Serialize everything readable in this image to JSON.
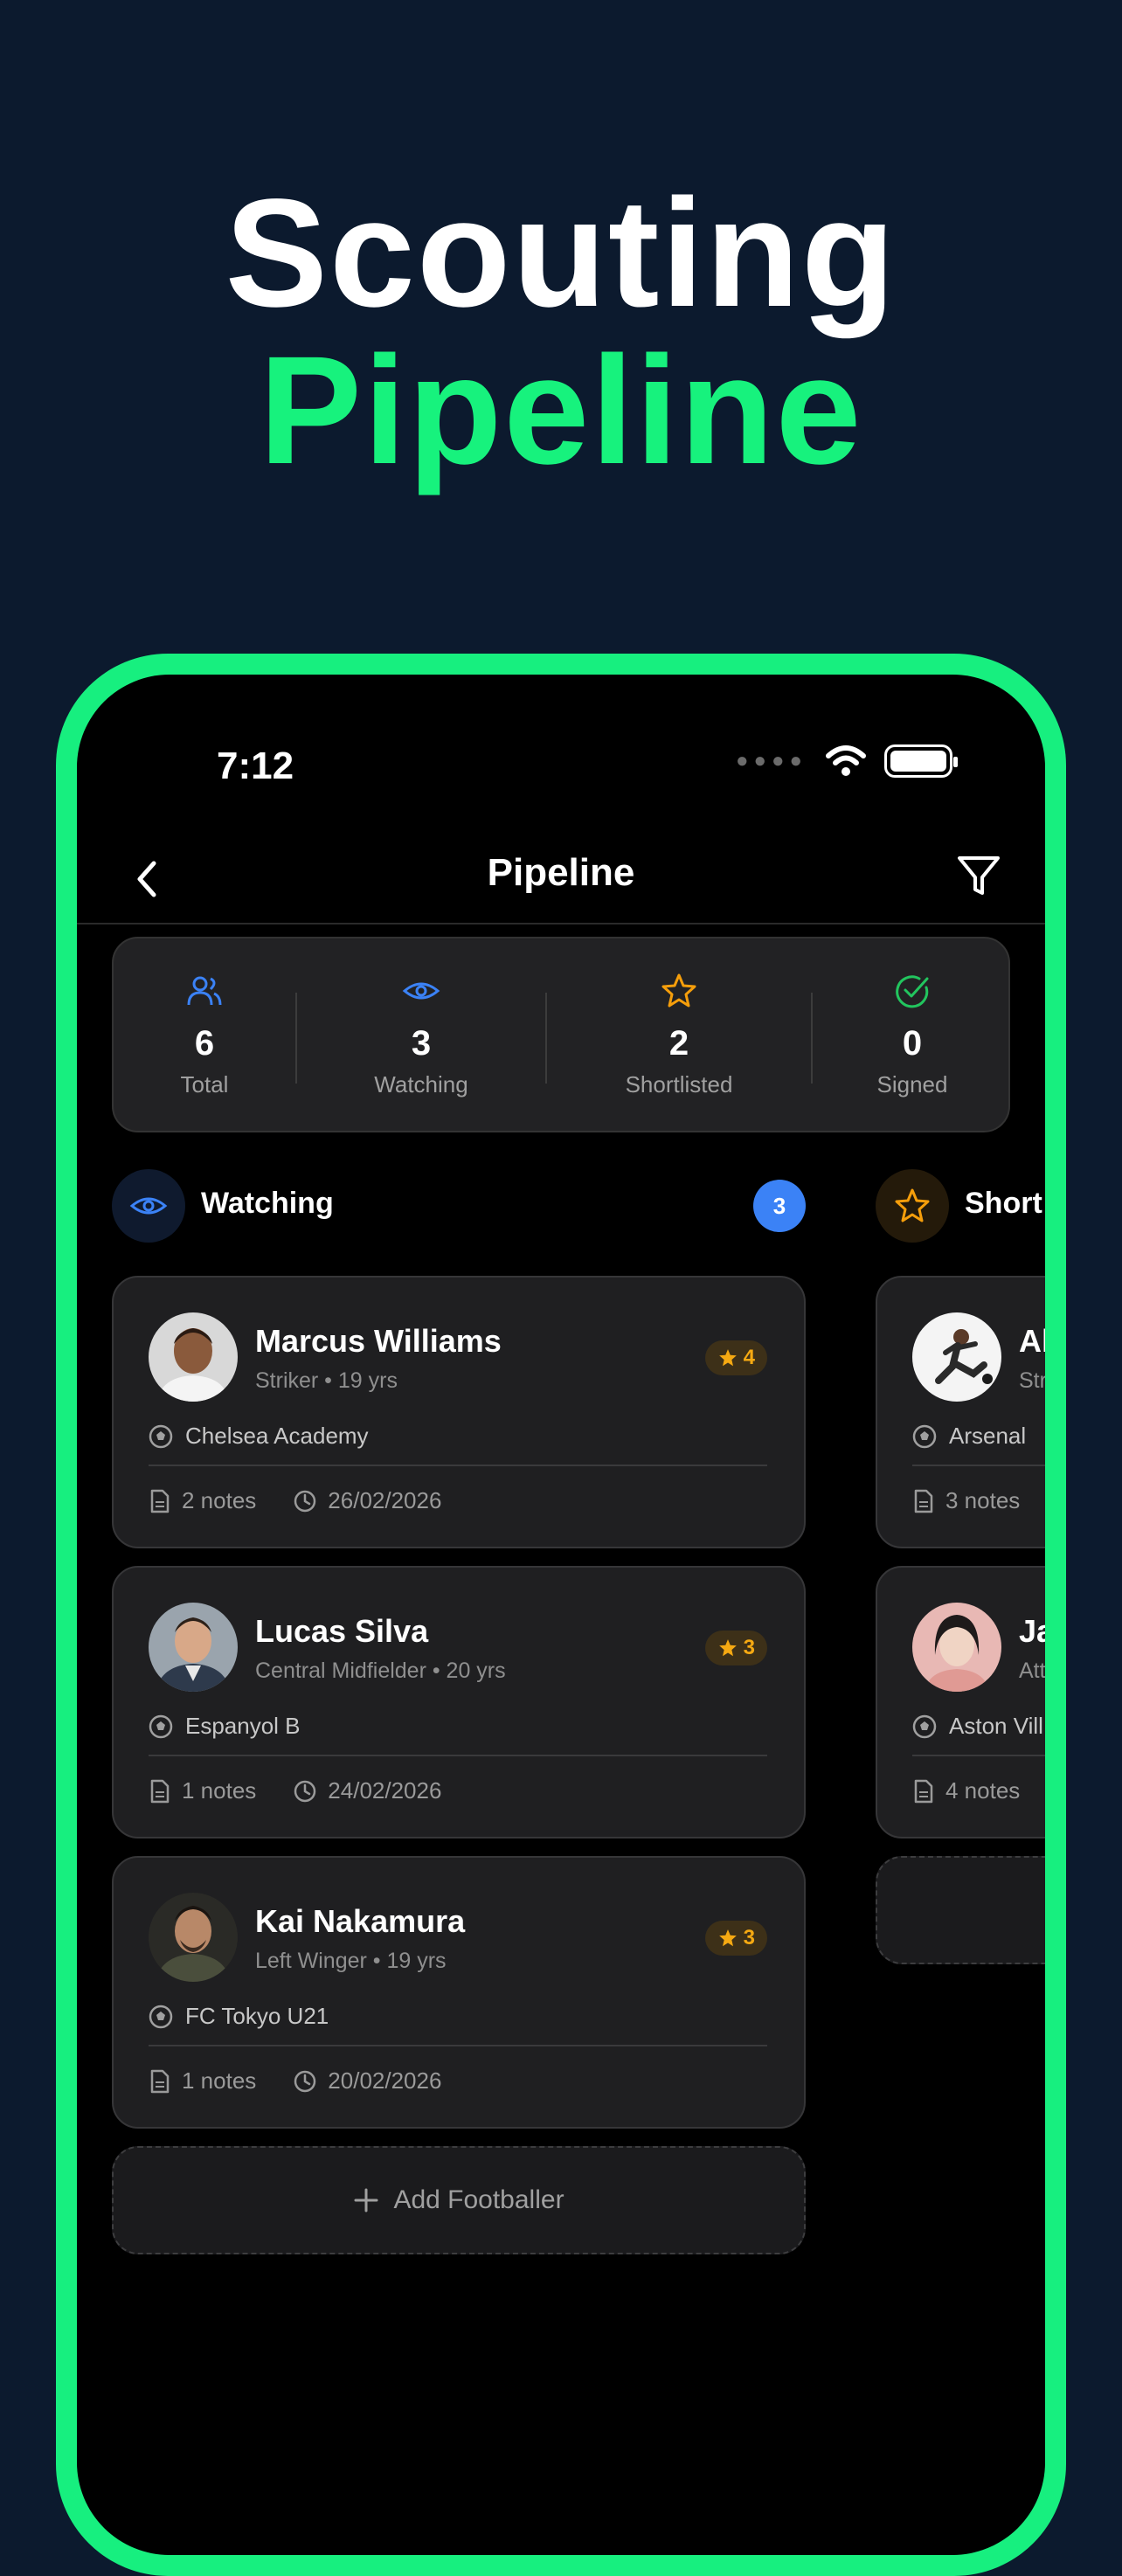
{
  "hero": {
    "line1": "Scouting",
    "line2": "Pipeline"
  },
  "status_bar": {
    "time": "7:12"
  },
  "nav": {
    "title": "Pipeline"
  },
  "stats": [
    {
      "number": "6",
      "label": "Total",
      "icon": "users-icon",
      "color": "#3b82f6"
    },
    {
      "number": "3",
      "label": "Watching",
      "icon": "eye-icon",
      "color": "#3b82f6"
    },
    {
      "number": "2",
      "label": "Shortlisted",
      "icon": "star-icon",
      "color": "#f59e0b"
    },
    {
      "number": "0",
      "label": "Signed",
      "icon": "check-circle-icon",
      "color": "#22c55e"
    }
  ],
  "columns": [
    {
      "title": "Watching",
      "count": "3",
      "cards": [
        {
          "name": "Marcus Williams",
          "meta": "Striker • 19 yrs",
          "rating": "4",
          "club": "Chelsea Academy",
          "notes": "2 notes",
          "date": "26/02/2026"
        },
        {
          "name": "Lucas Silva",
          "meta": "Central Midfielder • 20 yrs",
          "rating": "3",
          "club": "Espanyol B",
          "notes": "1 notes",
          "date": "24/02/2026"
        },
        {
          "name": "Kai Nakamura",
          "meta": "Left Winger • 19 yrs",
          "rating": "3",
          "club": "FC Tokyo U21",
          "notes": "1 notes",
          "date": "20/02/2026"
        }
      ],
      "add_label": "Add Footballer"
    },
    {
      "title": "Short",
      "cards": [
        {
          "name": "Al",
          "meta": "Str",
          "club": "Arsenal",
          "notes": "3 notes"
        },
        {
          "name": "Ja",
          "meta": "Att",
          "club": "Aston Vill",
          "notes": "4 notes"
        }
      ]
    }
  ],
  "colors": {
    "accent": "#17ef7f",
    "background": "#0c1a2e",
    "badge": "#3b82f6",
    "rating": "#f5a912"
  }
}
